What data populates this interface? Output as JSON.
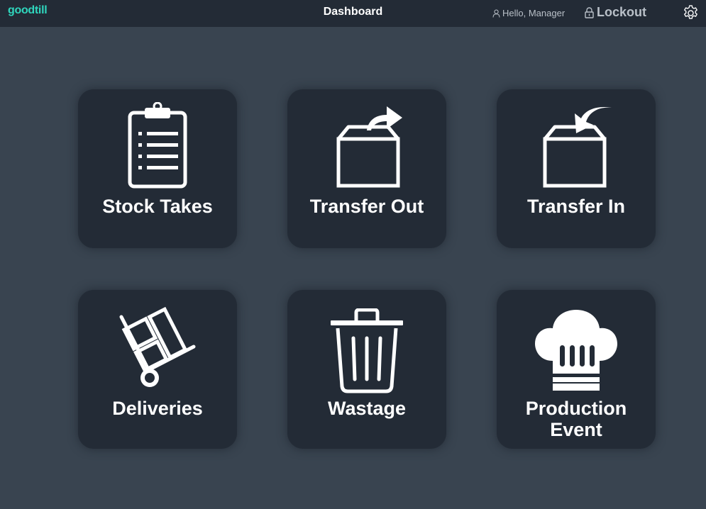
{
  "header": {
    "brand": "goodtill",
    "title": "Dashboard",
    "greeting": "Hello, Manager",
    "lockout_label": "Lockout",
    "settings_icon": "gear-icon"
  },
  "tiles": [
    {
      "id": "stock-takes",
      "label": "Stock Takes",
      "icon": "clipboard-icon"
    },
    {
      "id": "transfer-out",
      "label": "Transfer Out",
      "icon": "box-out-icon"
    },
    {
      "id": "transfer-in",
      "label": "Transfer In",
      "icon": "box-in-icon"
    },
    {
      "id": "deliveries",
      "label": "Deliveries",
      "icon": "hand-truck-icon"
    },
    {
      "id": "wastage",
      "label": "Wastage",
      "icon": "trash-icon"
    },
    {
      "id": "production-event",
      "label": "Production\nEvent",
      "icon": "chef-hat-icon"
    }
  ],
  "colors": {
    "background": "#394450",
    "topbar": "#232b36",
    "tile": "#232b36",
    "brand": "#2fd6bd",
    "muted_text": "#b9c0c8"
  }
}
